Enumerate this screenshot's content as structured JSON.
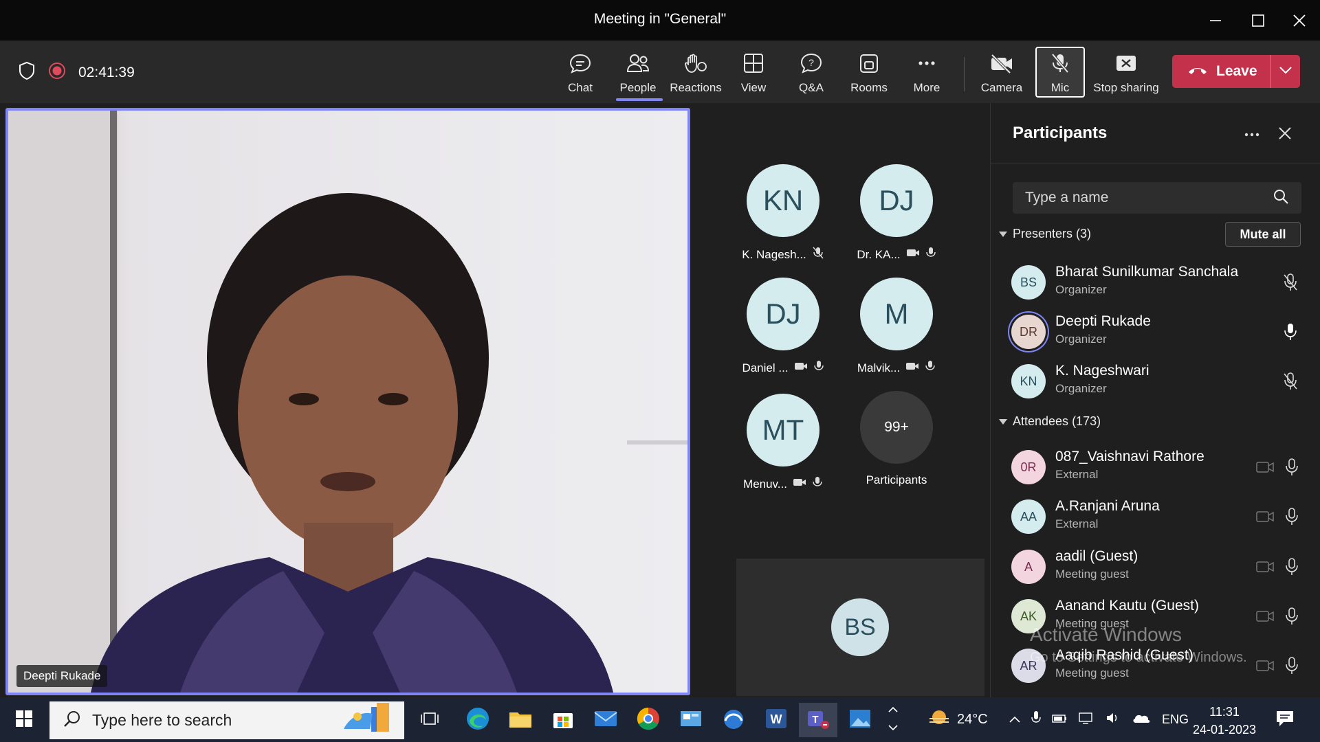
{
  "window": {
    "title": "Meeting in \"General\""
  },
  "toolbar": {
    "timer": "02:41:39",
    "buttons": {
      "chat": "Chat",
      "people": "People",
      "reactions": "Reactions",
      "view": "View",
      "qa": "Q&A",
      "rooms": "Rooms",
      "more": "More",
      "camera": "Camera",
      "mic": "Mic",
      "stop_sharing": "Stop sharing"
    },
    "leave": "Leave",
    "accent": "#7f85f5",
    "leave_color": "#c4314b"
  },
  "stage": {
    "main_speaker": "Deepti Rukade",
    "tiles": [
      {
        "initials": "KN",
        "name": "K. Nagesh...",
        "icons": [
          "mic-off-icon"
        ]
      },
      {
        "initials": "DJ",
        "name": "Dr. KA...",
        "icons": [
          "camera-off-icon",
          "mic-icon"
        ]
      },
      {
        "initials": "DJ",
        "name": "Daniel ...",
        "icons": [
          "camera-off-icon",
          "mic-icon"
        ]
      },
      {
        "initials": "M",
        "name": "Malvik...",
        "icons": [
          "camera-off-icon",
          "mic-icon"
        ]
      },
      {
        "initials": "MT",
        "name": "Menuv...",
        "icons": [
          "camera-off-icon",
          "mic-icon"
        ]
      },
      {
        "initials": "99+",
        "name": "Participants",
        "icons": []
      }
    ],
    "bottom_tile": "BS"
  },
  "sidebar": {
    "title": "Participants",
    "search_placeholder": "Type a name",
    "presenters_header": "Presenters (3)",
    "mute_all": "Mute all",
    "presenters": [
      {
        "initials": "BS",
        "name": "Bharat Sunilkumar Sanchala",
        "role": "Organizer",
        "mic": "mic-off-icon"
      },
      {
        "initials": "DR",
        "name": "Deepti Rukade",
        "role": "Organizer",
        "mic": "mic-on-icon"
      },
      {
        "initials": "KN",
        "name": "K. Nageshwari",
        "role": "Organizer",
        "mic": "mic-off-icon"
      }
    ],
    "attendees_header": "Attendees (173)",
    "attendees": [
      {
        "initials": "0R",
        "name": "087_Vaishnavi Rathore",
        "role": "External"
      },
      {
        "initials": "AA",
        "name": "A.Ranjani Aruna",
        "role": "External"
      },
      {
        "initials": "A",
        "name": "aadil (Guest)",
        "role": "Meeting guest"
      },
      {
        "initials": "AK",
        "name": "Aanand Kautu (Guest)",
        "role": "Meeting guest"
      },
      {
        "initials": "AR",
        "name": "Aaqib Rashid (Guest)",
        "role": "Meeting guest"
      }
    ]
  },
  "watermark": {
    "line1": "Activate Windows",
    "line2": "Go to Settings to activate Windows."
  },
  "taskbar": {
    "search_placeholder": "Type here to search",
    "weather": "24°C",
    "language": "ENG",
    "time": "11:31",
    "date": "24-01-2023"
  }
}
